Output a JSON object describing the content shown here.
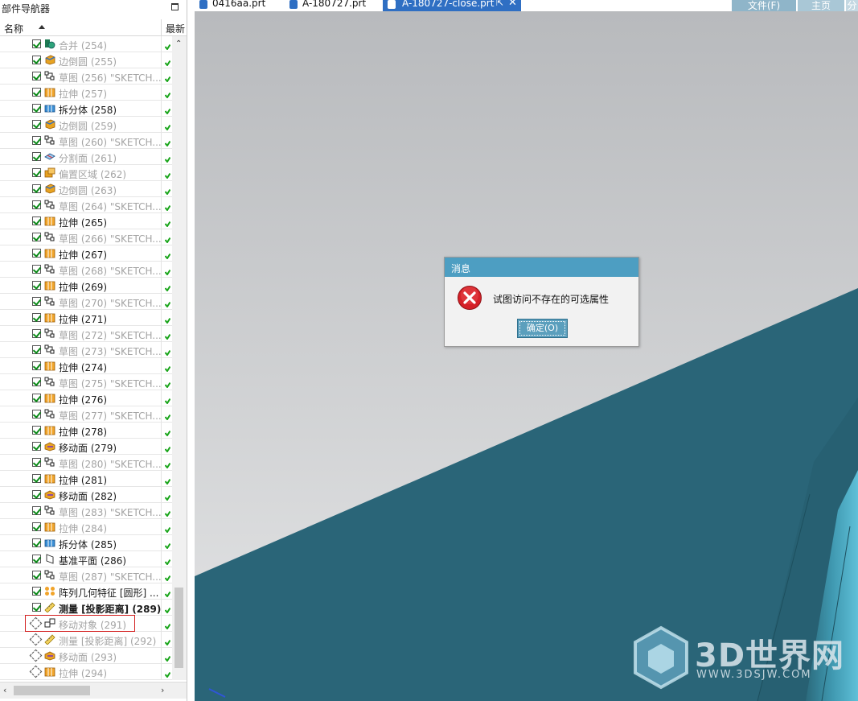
{
  "navigator": {
    "title": "部件导航器",
    "col_name": "名称",
    "col_latest": "最新",
    "rows": [
      {
        "label": "合并 (254)",
        "state": "dim",
        "check": "on",
        "icon": "unite-icon"
      },
      {
        "label": "边倒圆 (255)",
        "state": "dim",
        "check": "on",
        "icon": "edge-blend-icon"
      },
      {
        "label": "草图 (256) \"SKETCH...",
        "state": "dim",
        "check": "on",
        "icon": "sketch-icon"
      },
      {
        "label": "拉伸 (257)",
        "state": "dim",
        "check": "on",
        "icon": "extrude-icon"
      },
      {
        "label": "拆分体 (258)",
        "state": "normal",
        "check": "on",
        "icon": "split-body-icon"
      },
      {
        "label": "边倒圆 (259)",
        "state": "dim",
        "check": "on",
        "icon": "edge-blend-icon"
      },
      {
        "label": "草图 (260) \"SKETCH...",
        "state": "dim",
        "check": "on",
        "icon": "sketch-icon"
      },
      {
        "label": "分割面 (261)",
        "state": "dim",
        "check": "on",
        "icon": "divide-face-icon"
      },
      {
        "label": "偏置区域 (262)",
        "state": "dim",
        "check": "on",
        "icon": "offset-region-icon"
      },
      {
        "label": "边倒圆 (263)",
        "state": "dim",
        "check": "on",
        "icon": "edge-blend-icon"
      },
      {
        "label": "草图 (264) \"SKETCH...",
        "state": "dim",
        "check": "on",
        "icon": "sketch-icon"
      },
      {
        "label": "拉伸 (265)",
        "state": "normal",
        "check": "on",
        "icon": "extrude-icon"
      },
      {
        "label": "草图 (266) \"SKETCH...",
        "state": "dim",
        "check": "on",
        "icon": "sketch-icon"
      },
      {
        "label": "拉伸 (267)",
        "state": "normal",
        "check": "on",
        "icon": "extrude-icon"
      },
      {
        "label": "草图 (268) \"SKETCH...",
        "state": "dim",
        "check": "on",
        "icon": "sketch-icon"
      },
      {
        "label": "拉伸 (269)",
        "state": "normal",
        "check": "on",
        "icon": "extrude-icon"
      },
      {
        "label": "草图 (270) \"SKETCH...",
        "state": "dim",
        "check": "on",
        "icon": "sketch-icon"
      },
      {
        "label": "拉伸 (271)",
        "state": "normal",
        "check": "on",
        "icon": "extrude-icon"
      },
      {
        "label": "草图 (272) \"SKETCH...",
        "state": "dim",
        "check": "on",
        "icon": "sketch-icon"
      },
      {
        "label": "草图 (273) \"SKETCH...",
        "state": "dim",
        "check": "on",
        "icon": "sketch-icon"
      },
      {
        "label": "拉伸 (274)",
        "state": "normal",
        "check": "on",
        "icon": "extrude-icon"
      },
      {
        "label": "草图 (275) \"SKETCH...",
        "state": "dim",
        "check": "on",
        "icon": "sketch-icon"
      },
      {
        "label": "拉伸 (276)",
        "state": "normal",
        "check": "on",
        "icon": "extrude-icon"
      },
      {
        "label": "草图 (277) \"SKETCH...",
        "state": "dim",
        "check": "on",
        "icon": "sketch-icon"
      },
      {
        "label": "拉伸 (278)",
        "state": "normal",
        "check": "on",
        "icon": "extrude-icon"
      },
      {
        "label": "移动面 (279)",
        "state": "normal",
        "check": "on",
        "icon": "move-face-icon"
      },
      {
        "label": "草图 (280) \"SKETCH...",
        "state": "dim",
        "check": "on",
        "icon": "sketch-icon"
      },
      {
        "label": "拉伸 (281)",
        "state": "normal",
        "check": "on",
        "icon": "extrude-icon"
      },
      {
        "label": "移动面 (282)",
        "state": "normal",
        "check": "on",
        "icon": "move-face-icon"
      },
      {
        "label": "草图 (283) \"SKETCH...",
        "state": "dim",
        "check": "on",
        "icon": "sketch-icon"
      },
      {
        "label": "拉伸 (284)",
        "state": "dim",
        "check": "on",
        "icon": "extrude-icon"
      },
      {
        "label": "拆分体 (285)",
        "state": "normal",
        "check": "on",
        "icon": "split-body-icon"
      },
      {
        "label": "基准平面 (286)",
        "state": "normal",
        "check": "on",
        "icon": "datum-plane-icon"
      },
      {
        "label": "草图 (287) \"SKETCH...",
        "state": "dim",
        "check": "on",
        "icon": "sketch-icon"
      },
      {
        "label": "阵列几何特征 [圆形] ...",
        "state": "normal",
        "check": "on",
        "icon": "pattern-geometry-icon"
      },
      {
        "label": "测量 [投影距离] (289)",
        "state": "bold",
        "check": "on",
        "icon": "measure-icon"
      },
      {
        "label": "移动对象 (291)",
        "state": "dim",
        "check": "off",
        "icon": "move-object-icon"
      },
      {
        "label": "测量 [投影距离] (292)",
        "state": "dim",
        "check": "off",
        "icon": "measure-icon"
      },
      {
        "label": "移动面 (293)",
        "state": "dim",
        "check": "off",
        "icon": "move-face-icon"
      },
      {
        "label": "拉伸 (294)",
        "state": "dim",
        "check": "off",
        "icon": "extrude-icon"
      }
    ]
  },
  "tabs": [
    {
      "label": "0416aa.prt"
    },
    {
      "label": "A-180727.prt"
    },
    {
      "label": "A-180727-close.prt"
    }
  ],
  "menu": {
    "file": "文件(F)",
    "home": "主页",
    "more": "分"
  },
  "dialog": {
    "title": "消息",
    "message": "试图访问不存在的可选属性",
    "ok": "确定(O)"
  },
  "watermark": {
    "brand": "3D世界网",
    "url": "WWW.3DSJW.COM"
  },
  "colors": {
    "viewport_gray": "#c6c8ca",
    "model_teal": "#2a6578",
    "dialog_title": "#4d9ec2",
    "active_tab": "#2f6fc3",
    "highlight_box": "#d21f1f"
  }
}
